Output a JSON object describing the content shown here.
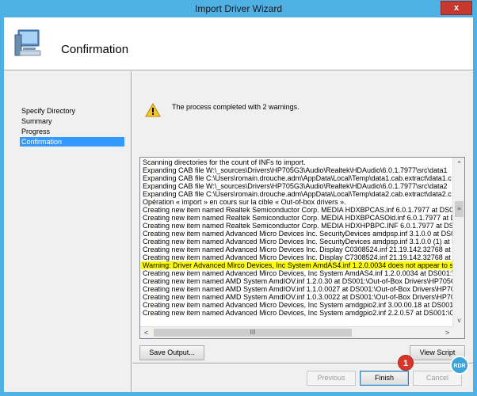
{
  "window": {
    "title": "Import Driver Wizard",
    "close_glyph": "x"
  },
  "header": {
    "title": "Confirmation",
    "icon": "computer-icon"
  },
  "nav": {
    "items": [
      {
        "label": "Specify Directory"
      },
      {
        "label": "Summary"
      },
      {
        "label": "Progress"
      },
      {
        "label": "Confirmation"
      }
    ]
  },
  "status": {
    "message": "The process completed with 2 warnings.",
    "icon": "warning-icon"
  },
  "log": {
    "lines": [
      "Scanning directories for the count of INFs to import.",
      "Expanding CAB file W:\\_sources\\Drivers\\HP705G3\\Audio\\Realtek\\HDAudio\\6.0.1.7977\\src\\data1",
      "Expanding CAB file C:\\Users\\romain.drouche.adm\\AppData\\Local\\Temp\\data1.cab.extract\\data1.c",
      "Expanding CAB file W:\\_sources\\Drivers\\HP705G3\\Audio\\Realtek\\HDAudio\\6.0.1.7977\\src\\data2",
      "Expanding CAB file C:\\Users\\romain.drouche.adm\\AppData\\Local\\Temp\\data2.cab.extract\\data2.c",
      "Opération « import » en cours sur la cible « Out-of-box drivers ».",
      "Creating new item named Realtek Semiconductor Corp. MEDIA HDXBPCAS.inf 6.0.1.7977 at DS001",
      "Creating new item named Realtek Semiconductor Corp. MEDIA HDXBPCASOld.inf 6.0.1.7977 at DS",
      "Creating new item named Realtek Semiconductor Corp. MEDIA HDXHPBPC.INF 6.0.1.7977 at DS001",
      "Creating new item named Advanced Micro Devices Inc. SecurityDevices amdpsp.inf 3.1.0.0 at DS0",
      "Creating new item named Advanced Micro Devices Inc. SecurityDevices amdpsp.inf 3.1.0.0 (1) at DS",
      "Creating new item named Advanced Micro Devices Inc. Display C0308524.inf 21.19.142.32768 at D",
      "Creating new item named Advanced Micro Devices Inc. Display C7308524.inf 21.19.142.32768 at D",
      "Warning: Driver Advanced Mirco Devices, Inc System AmdAS4.inf 1.2.0.0034 does not appear to su",
      "Creating new item named Advanced Mirco Devices, Inc System AmdAS4.inf 1.2.0.0034 at DS001:\\C",
      "Creating new item named AMD System AmdIOV.inf 1.2.0.30 at DS001:\\Out-of-Box Drivers\\HP705G3",
      "Creating new item named AMD System AmdIOV.inf 1.1.0.0027 at DS001:\\Out-of-Box Drivers\\HP705",
      "Creating new item named AMD System AmdIOV.inf 1.0.3.0022 at DS001:\\Out-of-Box Drivers\\HP705",
      "Creating new item named Advanced Micro Devices, Inc System amdgpio2.inf 3.00.00.18 at DS001:\\",
      "Creating new item named Advanced Micro Devices, Inc System amdgpio2.inf 2.2.0.57 at DS001:\\Ou"
    ],
    "highlight_index": 13,
    "highlight_color": "#ffff00",
    "scroll": {
      "up": "^",
      "down": "v",
      "left": "<",
      "right": ">",
      "thumb_v": "≡",
      "thumb_h": "III"
    }
  },
  "buttons": {
    "save_output": "Save Output...",
    "view_script": "View Script",
    "previous": "Previous",
    "finish": "Finish",
    "cancel": "Cancel"
  },
  "annotation": {
    "badge": "1",
    "watermark": "RDR"
  },
  "colors": {
    "title_bar": "#4fb0e3",
    "selection": "#3399ff",
    "close": "#c7392f",
    "badge": "#d9352a"
  }
}
